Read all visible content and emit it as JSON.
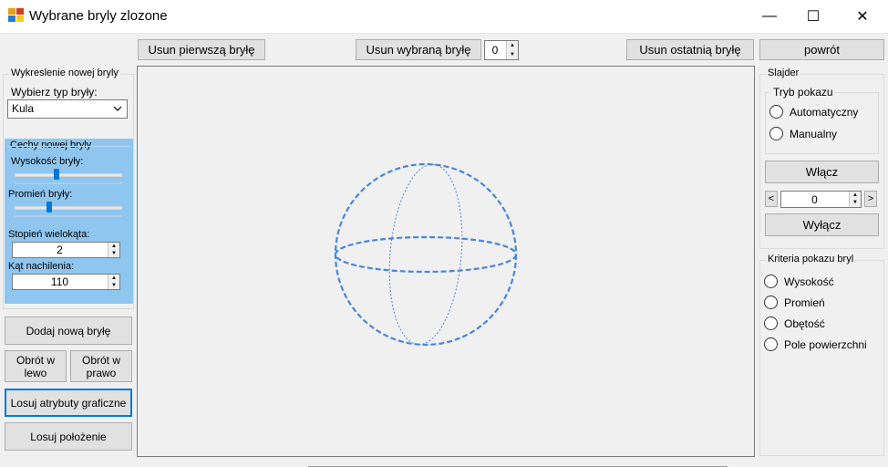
{
  "window": {
    "title": "Wybrane bryly zlozone",
    "minimize_glyph": "—",
    "maximize_glyph": "☐",
    "close_glyph": "✕"
  },
  "toolbar": {
    "remove_first": "Usun pierwszą bryłę",
    "remove_selected": "Usun wybraną bryłę",
    "selected_index": "0",
    "remove_last": "Usun ostatnią bryłę",
    "back": "powrót"
  },
  "left": {
    "group_new": "Wykreslenie nowej bryly",
    "choose_type_label": "Wybierz typ bryły:",
    "type_value": "Kula",
    "features_group": "Cechy nowej bryly",
    "height_label": "Wysokość bryły:",
    "height_level": 0.38,
    "radius_label": "Promień bryły:",
    "radius_level": 0.31,
    "polygon_label": "Stopień wielokąta:",
    "polygon_value": "2",
    "tilt_label": "Kąt nachilenia:",
    "tilt_value": "110",
    "add_button": "Dodaj nową bryłę",
    "rotate_left": "Obrót w lewo",
    "rotate_right": "Obrót w prawo",
    "random_attrs": "Losuj atrybuty graficzne",
    "random_position": "Losuj położenie"
  },
  "right": {
    "slider_group": "Slajder",
    "mode_group": "Tryb pokazu",
    "mode_auto": "Automatyczny",
    "mode_manual": "Manualny",
    "enable_button": "Włącz",
    "prev": "<",
    "next": ">",
    "slide_index": "0",
    "disable_button": "Wyłącz",
    "criteria_group": "Kriteria pokazu bryl",
    "criteria": [
      "Wysokość",
      "Promień",
      "Obętość",
      "Pole powierzchni"
    ]
  },
  "colors": {
    "sphere_stroke": "#4a86d8",
    "panel_blue": "#8ec6f0",
    "focus_border": "#0078d7"
  }
}
